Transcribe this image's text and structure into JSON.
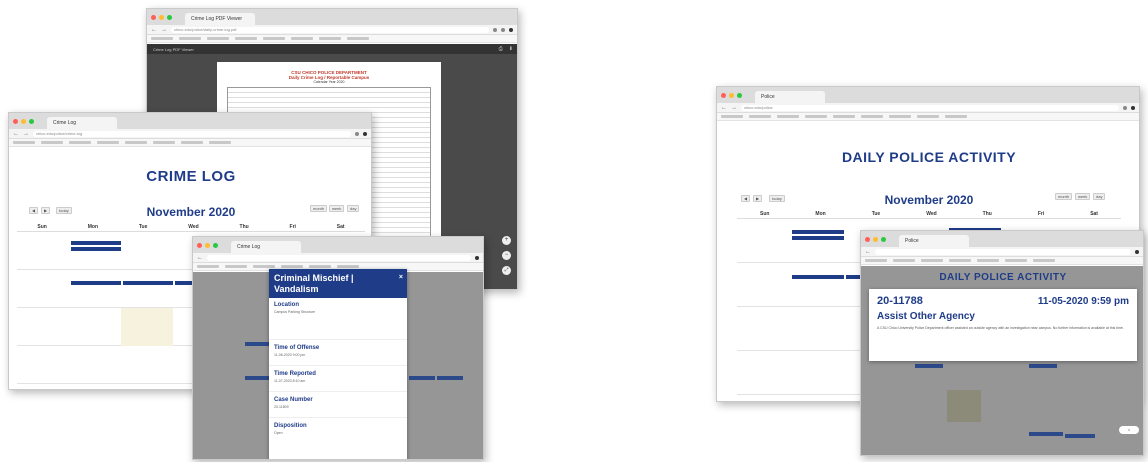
{
  "left_pdf_window": {
    "tab": "Crime Log PDF Viewer",
    "url": "chico.edu/police/daily-crime-log.pdf",
    "toolbar_title": "Crime Log PDF Viewer",
    "doc_title": "CSU CHICO POLICE DEPARTMENT",
    "doc_subtitle": "Daily Crime Log / Reportable Campus",
    "doc_date": "Calendar Year 2020"
  },
  "left_calendar_window": {
    "tab": "Crime Log",
    "url": "chico.edu/police/crime-log",
    "page_title": "CRIME LOG",
    "month": "November 2020",
    "days": [
      "Sun",
      "Mon",
      "Tue",
      "Wed",
      "Thu",
      "Fri",
      "Sat"
    ],
    "view_buttons": [
      "month",
      "week",
      "day"
    ],
    "nav_today": "today"
  },
  "left_popup_window": {
    "tab": "Crime Log",
    "popup_title": "Criminal Mischief | Vandalism",
    "close_label": "×",
    "fields": [
      {
        "label": "Location",
        "value": "Campus Parking Structure"
      },
      {
        "label": "Time of Offense",
        "value": "11-06-2020 9:00 pm"
      },
      {
        "label": "Time Reported",
        "value": "11-07-2020 8:10 am"
      },
      {
        "label": "Case Number",
        "value": "20-11809"
      },
      {
        "label": "Disposition",
        "value": "Open"
      }
    ]
  },
  "right_calendar_window": {
    "tab": "Police",
    "url": "chico.edu/police",
    "page_title": "DAILY POLICE ACTIVITY",
    "month": "November 2020",
    "days": [
      "Sun",
      "Mon",
      "Tue",
      "Wed",
      "Thu",
      "Fri",
      "Sat"
    ],
    "view_buttons": [
      "month",
      "week",
      "day"
    ],
    "nav_today": "today"
  },
  "right_popup_window": {
    "tab": "Police",
    "page_title": "DAILY POLICE ACTIVITY",
    "case_number": "20-11788",
    "datetime": "11-05-2020 9:59 pm",
    "event_title": "Assist Other Agency",
    "description": "A CSU Chico University Police Department officer assisted an outside agency with an investigation near campus. No further information is available at this time."
  },
  "colors": {
    "brand_blue": "#1f3c88",
    "pdf_dark": "#4a4a4a",
    "overlay_gray": "#6e6e6e"
  }
}
